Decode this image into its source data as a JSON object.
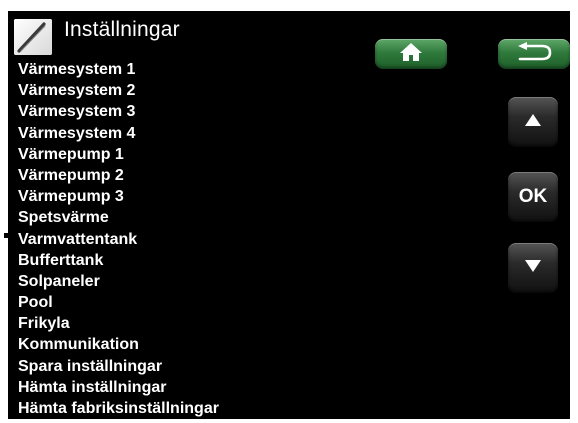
{
  "header": {
    "title": "Inställningar",
    "icon": "wrench-pen-icon"
  },
  "menu": {
    "items": [
      "Värmesystem 1",
      "Värmesystem 2",
      "Värmesystem 3",
      "Värmesystem 4",
      "Värmepump 1",
      "Värmepump 2",
      "Värmepump 3",
      "Spetsvärme",
      "Varmvattentank",
      "Bufferttank",
      "Solpaneler",
      "Pool",
      "Frikyla",
      "Kommunikation",
      "Spara inställningar",
      "Hämta inställningar",
      "Hämta fabriksinställningar"
    ]
  },
  "nav": {
    "home_icon": "home-icon",
    "back_icon": "return-arrow-icon",
    "up_icon": "up-arrow-icon",
    "ok_label": "OK",
    "down_icon": "down-arrow-icon"
  },
  "colors": {
    "background": "#000000",
    "text": "#ffffff",
    "nav_green": "#2f7a3c",
    "side_button": "#2a2a2a"
  }
}
